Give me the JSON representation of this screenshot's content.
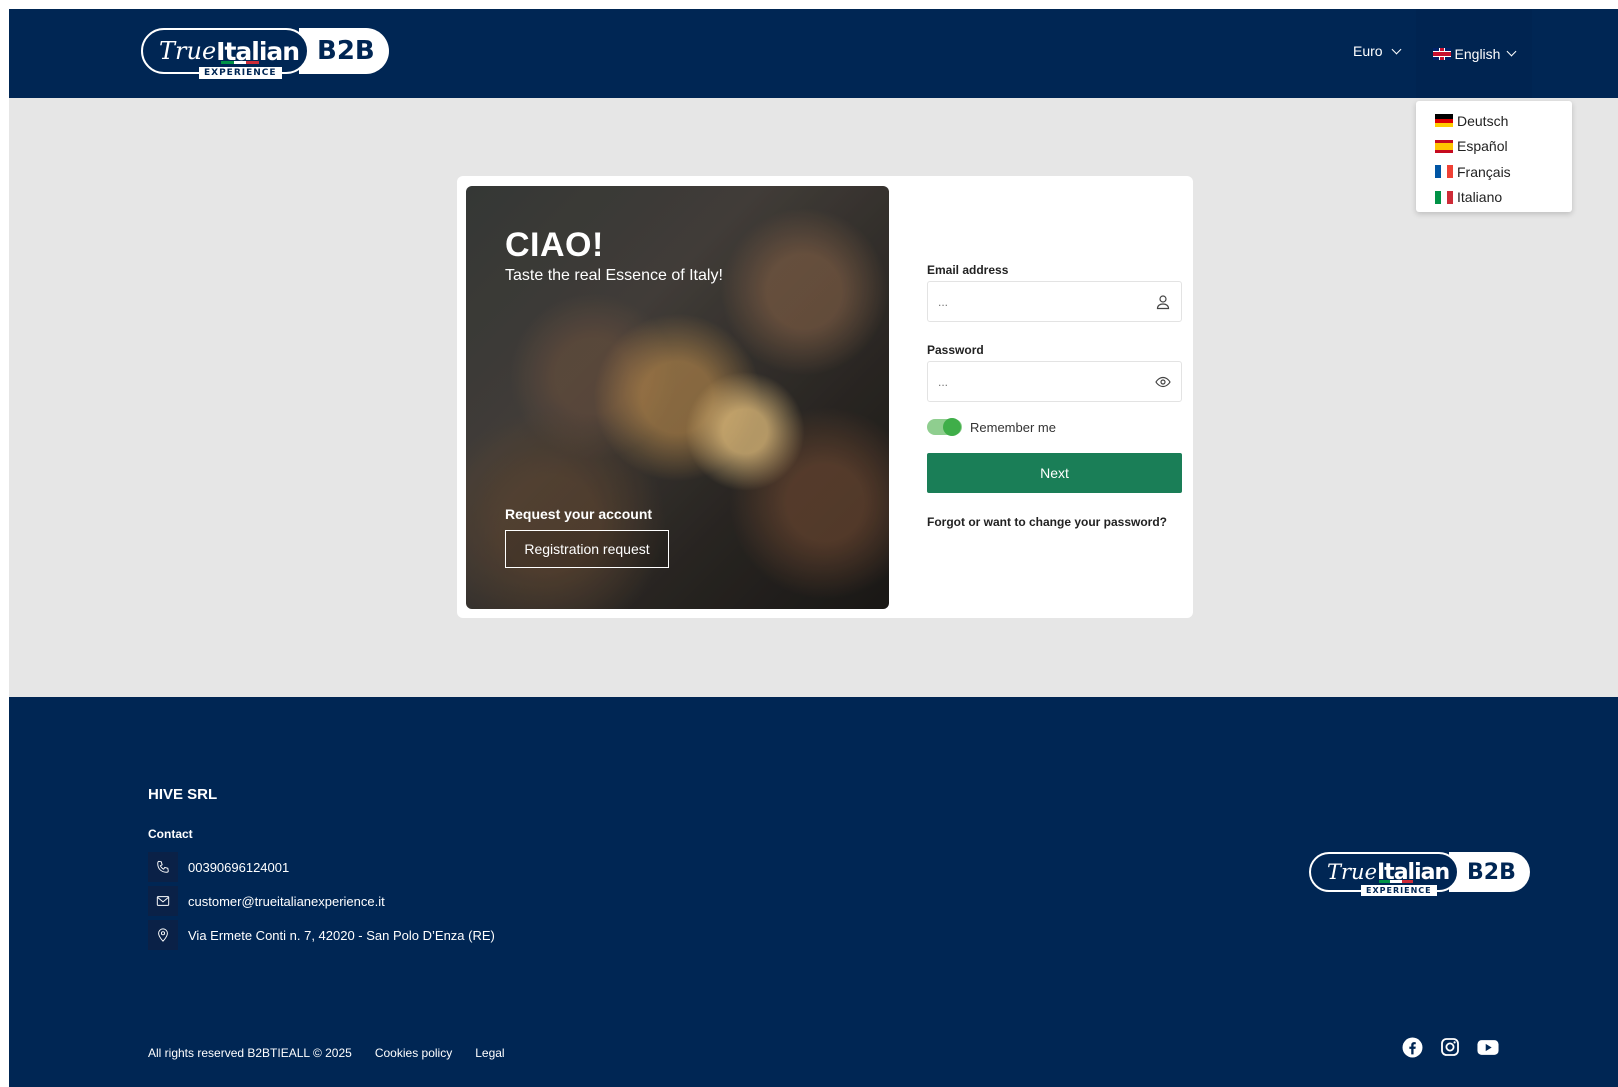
{
  "brand": {
    "logo_true": "True",
    "logo_italian": "Italian",
    "logo_experience": "EXPERIENCE",
    "logo_b2b": "B2B",
    "colors": {
      "navy": "#002654",
      "green": "#1a7e57",
      "flag_green": "#009246",
      "flag_red": "#ce2b37"
    }
  },
  "header": {
    "currency_label": "Euro",
    "language_label": "English",
    "language_options": [
      {
        "label": "Deutsch",
        "flag": "de-flag-icon"
      },
      {
        "label": "Español",
        "flag": "es-flag-icon"
      },
      {
        "label": "Français",
        "flag": "fr-flag-icon"
      },
      {
        "label": "Italiano",
        "flag": "it-flag-icon"
      }
    ]
  },
  "hero": {
    "title": "CIAO!",
    "subtitle": "Taste the real Essence of Italy!",
    "request_title": "Request your account",
    "request_button": "Registration request"
  },
  "login": {
    "email_label": "Email address",
    "email_placeholder": "...",
    "password_label": "Password",
    "password_placeholder": "...",
    "remember_label": "Remember me",
    "remember_on": true,
    "next_button": "Next",
    "forgot_link": "Forgot or want to change your password?"
  },
  "footer": {
    "company": "HIVE SRL",
    "contact_heading": "Contact",
    "phone": "00390696124001",
    "email": "customer@trueitalianexperience.it",
    "address": "Via Ermete Conti n. 7, 42020 - San Polo D’Enza (RE)",
    "copyright": "All rights reserved B2BTIEALL © 2025",
    "cookies_link": "Cookies policy",
    "legal_link": "Legal",
    "socials": [
      "facebook-icon",
      "instagram-icon",
      "youtube-icon"
    ]
  }
}
